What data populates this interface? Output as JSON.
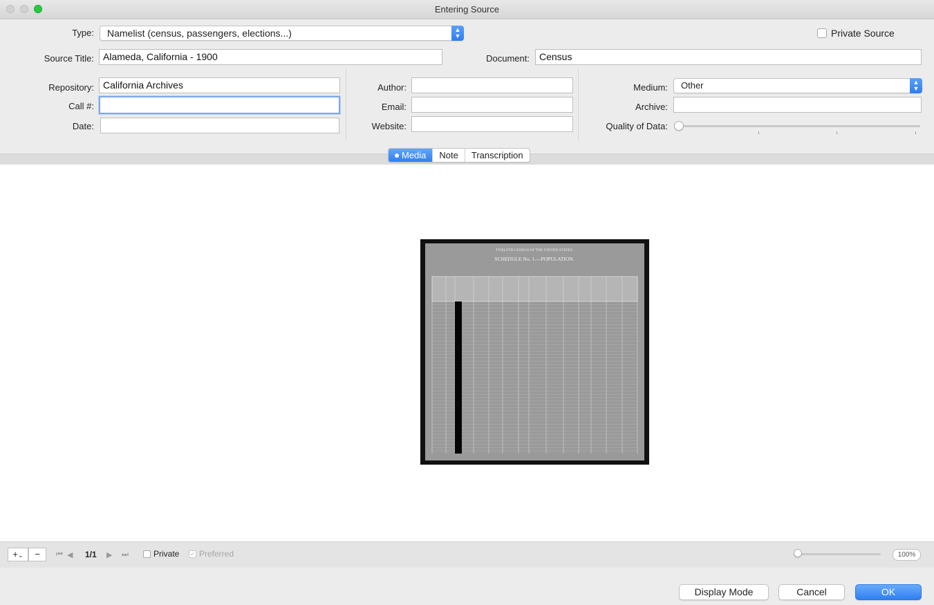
{
  "window": {
    "title": "Entering Source"
  },
  "form": {
    "type_label": "Type:",
    "type_value": "Namelist (census, passengers, elections...)",
    "private_source_label": "Private Source",
    "source_title_label": "Source Title:",
    "source_title_value": "Alameda, California - 1900",
    "document_label": "Document:",
    "document_value": "Census",
    "repository_label": "Repository:",
    "repository_value": "California Archives",
    "call_label": "Call #:",
    "call_value": "",
    "date_label": "Date:",
    "date_value": "",
    "author_label": "Author:",
    "author_value": "",
    "email_label": "Email:",
    "email_value": "",
    "website_label": "Website:",
    "website_value": "",
    "medium_label": "Medium:",
    "medium_value": "Other",
    "archive_label": "Archive:",
    "archive_value": "",
    "quality_label": "Quality of Data:",
    "quality_level": 0
  },
  "tabs": [
    {
      "label": "Media",
      "active": true
    },
    {
      "label": "Note",
      "active": false
    },
    {
      "label": "Transcription",
      "active": false
    }
  ],
  "media": {
    "image_title": "TWELFTH CENSUS OF THE UNITED STATES.",
    "image_schedule": "SCHEDULE No. 1.—POPULATION."
  },
  "bottombar": {
    "add_label": "+",
    "remove_label": "−",
    "page_counter": "1/1",
    "private_label": "Private",
    "preferred_label": "Preferred",
    "zoom_label": "100%",
    "zoom_level": 0
  },
  "buttons": {
    "display_mode": "Display Mode",
    "cancel": "Cancel",
    "ok": "OK"
  },
  "colors": {
    "accent": "#2f7ff1",
    "close_dot": "#d2d2d2",
    "max_dot": "#27c93f"
  }
}
